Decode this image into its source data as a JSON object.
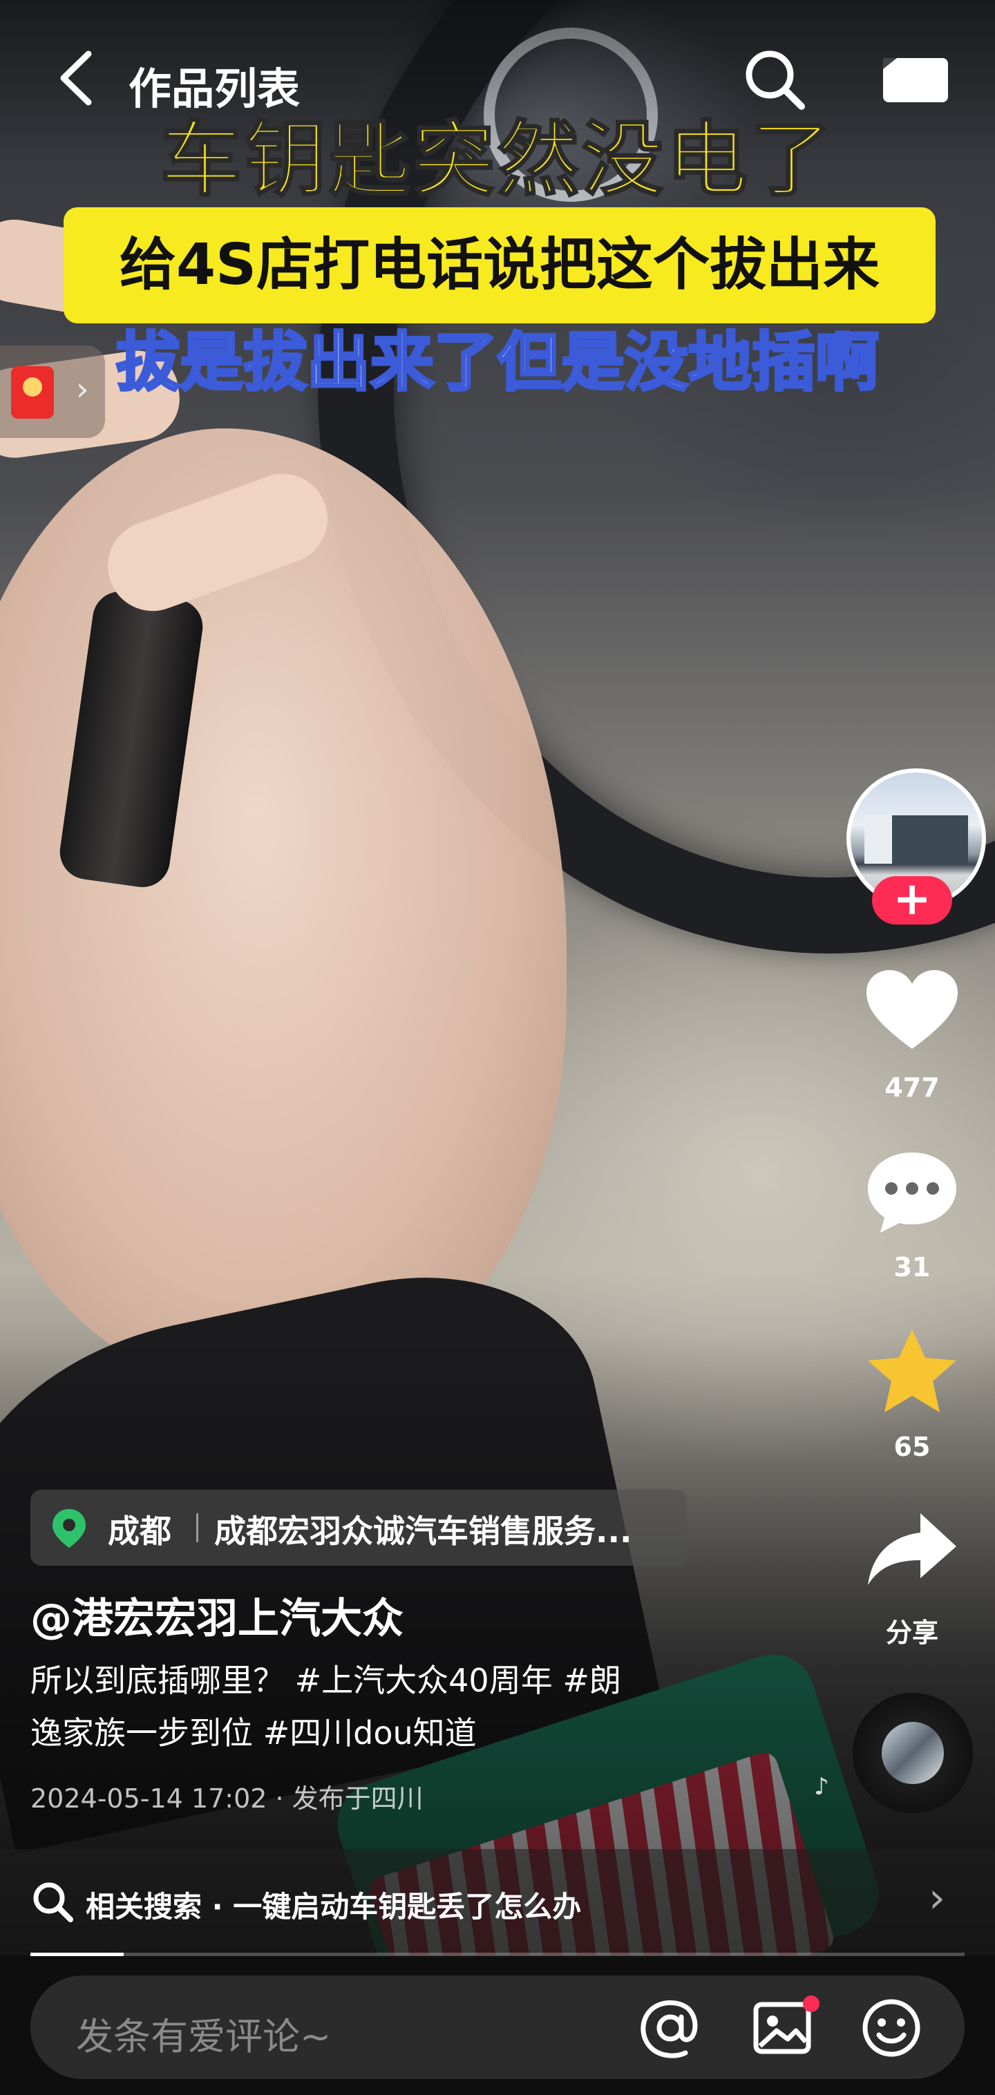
{
  "header": {
    "back_label": "作品列表"
  },
  "video": {
    "caption_line1": "车钥匙突然没电了",
    "caption_line2": "给4S店打电话说把这个拔出来",
    "caption_line3": "拔是拔出来了但是没地插啊"
  },
  "actions": {
    "likes": "477",
    "comments": "31",
    "favorites": "65",
    "share_label": "分享"
  },
  "location": {
    "city": "成都",
    "place": "成都宏羽众诚汽车销售服务..."
  },
  "author": "@港宏宏羽上汽大众",
  "description": {
    "line1": "所以到底插哪里？ #上汽大众40周年 #朗",
    "line2": "逸家族一步到位 #四川dou知道"
  },
  "timestamp": "2024-05-14 17:02 · 发布于四川",
  "related_search": "相关搜索 · 一键启动车钥匙丢了怎么办",
  "playback_progress": 0.1,
  "comment_input": {
    "placeholder": "发条有爱评论~"
  },
  "colors": {
    "accent": "#fe2c55",
    "caption_yellow": "#f6e21a",
    "favorite": "#f7c531",
    "location_pin": "#2ec36b"
  },
  "icons": [
    "chevron-left-icon",
    "search-icon",
    "tv-icon",
    "red-envelope-icon",
    "heart-icon",
    "comment-icon",
    "star-icon",
    "share-icon",
    "music-note-icon",
    "location-pin-icon",
    "chevron-right-icon",
    "at-icon",
    "image-icon",
    "emoji-icon"
  ]
}
